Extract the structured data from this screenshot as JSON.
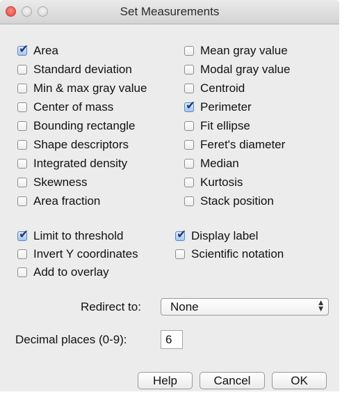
{
  "window": {
    "title": "Set Measurements"
  },
  "measurements": {
    "area": {
      "label": "Area",
      "checked": true
    },
    "mean_gray_value": {
      "label": "Mean gray value",
      "checked": false
    },
    "standard_deviation": {
      "label": "Standard deviation",
      "checked": false
    },
    "modal_gray_value": {
      "label": "Modal gray value",
      "checked": false
    },
    "min_max_gray_value": {
      "label": "Min & max gray value",
      "checked": false
    },
    "centroid": {
      "label": "Centroid",
      "checked": false
    },
    "center_of_mass": {
      "label": "Center of mass",
      "checked": false
    },
    "perimeter": {
      "label": "Perimeter",
      "checked": true
    },
    "bounding_rectangle": {
      "label": "Bounding rectangle",
      "checked": false
    },
    "fit_ellipse": {
      "label": "Fit ellipse",
      "checked": false
    },
    "shape_descriptors": {
      "label": "Shape descriptors",
      "checked": false
    },
    "ferets_diameter": {
      "label": "Feret's diameter",
      "checked": false
    },
    "integrated_density": {
      "label": "Integrated density",
      "checked": false
    },
    "median": {
      "label": "Median",
      "checked": false
    },
    "skewness": {
      "label": "Skewness",
      "checked": false
    },
    "kurtosis": {
      "label": "Kurtosis",
      "checked": false
    },
    "area_fraction": {
      "label": "Area fraction",
      "checked": false
    },
    "stack_position": {
      "label": "Stack position",
      "checked": false
    }
  },
  "options": {
    "limit_to_threshold": {
      "label": "Limit to threshold",
      "checked": true
    },
    "display_label": {
      "label": "Display label",
      "checked": true
    },
    "invert_y_coordinates": {
      "label": "Invert Y coordinates",
      "checked": false
    },
    "scientific_notation": {
      "label": "Scientific notation",
      "checked": false
    },
    "add_to_overlay": {
      "label": "Add to overlay",
      "checked": false
    }
  },
  "redirect": {
    "label": "Redirect to:",
    "value": "None"
  },
  "decimal": {
    "label": "Decimal places (0-9):",
    "value": "6"
  },
  "buttons": {
    "help": "Help",
    "cancel": "Cancel",
    "ok": "OK"
  },
  "icons": {
    "checkmark": "✔",
    "arrow_up": "▲",
    "arrow_down": "▼"
  }
}
